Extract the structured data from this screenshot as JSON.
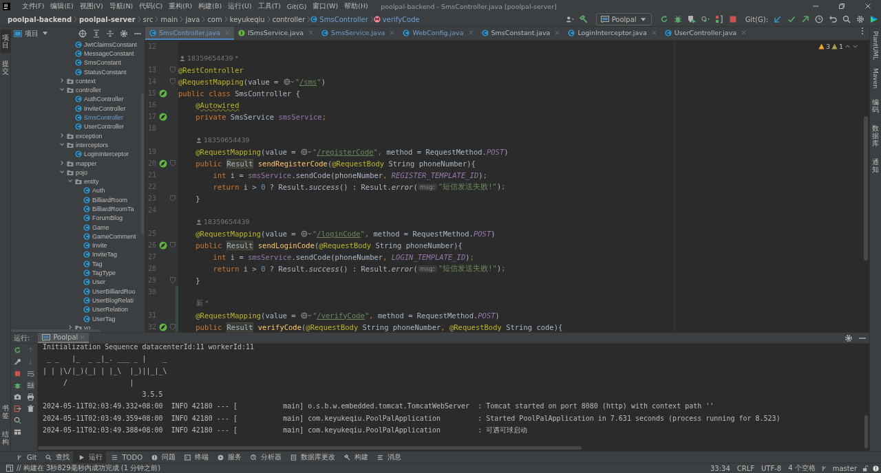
{
  "window": {
    "title": "poolpal-backend - SmsController.java [poolpal-server]"
  },
  "menu": [
    "文件(F)",
    "编辑(E)",
    "视图(V)",
    "导航(N)",
    "代码(C)",
    "重构(R)",
    "构建(B)",
    "运行(U)",
    "工具(T)",
    "Git(G)",
    "窗口(W)",
    "帮助(H)"
  ],
  "breadcrumbs": [
    {
      "label": "poolpal-backend",
      "kind": "module"
    },
    {
      "label": "poolpal-server",
      "kind": "module"
    },
    {
      "label": "src",
      "kind": "folder"
    },
    {
      "label": "main",
      "kind": "folder"
    },
    {
      "label": "java",
      "kind": "folder"
    },
    {
      "label": "com",
      "kind": "folder"
    },
    {
      "label": "keyukeqiu",
      "kind": "folder"
    },
    {
      "label": "controller",
      "kind": "folder"
    },
    {
      "label": "SmsController",
      "kind": "class"
    },
    {
      "label": "verifyCode",
      "kind": "method"
    }
  ],
  "toolbar": {
    "run_config": "Poolpal",
    "git_label": "Git(G):"
  },
  "left_strip": {
    "top": [
      {
        "label": "项目",
        "selected": true
      },
      {
        "label": "提交",
        "selected": false
      }
    ],
    "bottom": [
      "书签",
      "结构"
    ]
  },
  "right_strip": [
    {
      "label": "PlantUML",
      "kind": "rotated"
    },
    {
      "label": "Maven",
      "kind": "rotated"
    },
    {
      "label": "编码",
      "kind": "stacked"
    },
    {
      "label": "数据库",
      "kind": "stacked"
    },
    {
      "label": "通知",
      "kind": "stacked"
    }
  ],
  "project": {
    "title": "项目",
    "tree": {
      "continued_items": [
        {
          "label": "JwtClaimsConstant",
          "kind": "class",
          "modified": false
        },
        {
          "label": "MessageConstant",
          "kind": "class",
          "modified": false
        },
        {
          "label": "SmsConstant",
          "kind": "class",
          "modified": false
        },
        {
          "label": "StatusConstant",
          "kind": "class",
          "modified": false
        }
      ],
      "items": [
        {
          "label": "context",
          "kind": "folder",
          "expanded": false
        },
        {
          "label": "controller",
          "kind": "folder",
          "expanded": true,
          "children": [
            {
              "label": "AuthController",
              "kind": "class",
              "modified": false
            },
            {
              "label": "InviteController",
              "kind": "class",
              "modified": false
            },
            {
              "label": "SmsController",
              "kind": "class",
              "modified": true
            },
            {
              "label": "UserController",
              "kind": "class",
              "modified": false
            }
          ]
        },
        {
          "label": "exception",
          "kind": "folder",
          "expanded": false
        },
        {
          "label": "interceptors",
          "kind": "folder",
          "expanded": true,
          "children": [
            {
              "label": "LoginInterceptor",
              "kind": "class",
              "modified": false
            }
          ]
        },
        {
          "label": "mapper",
          "kind": "folder",
          "expanded": false
        },
        {
          "label": "pojo",
          "kind": "folder",
          "expanded": true,
          "children": [
            {
              "label": "entity",
              "kind": "folder",
              "expanded": true,
              "children": [
                {
                  "label": "Auth",
                  "kind": "class",
                  "modified": false
                },
                {
                  "label": "BilliardRoom",
                  "kind": "class",
                  "modified": false
                },
                {
                  "label": "BilliardRoomTa",
                  "kind": "class",
                  "modified": false
                },
                {
                  "label": "ForumBlog",
                  "kind": "class",
                  "modified": false
                },
                {
                  "label": "Game",
                  "kind": "class",
                  "modified": false
                },
                {
                  "label": "GameComment",
                  "kind": "class",
                  "modified": false
                },
                {
                  "label": "Invite",
                  "kind": "class",
                  "modified": false
                },
                {
                  "label": "InviteTag",
                  "kind": "class",
                  "modified": false
                },
                {
                  "label": "Tag",
                  "kind": "class",
                  "modified": false
                },
                {
                  "label": "TagType",
                  "kind": "class",
                  "modified": false
                },
                {
                  "label": "User",
                  "kind": "class",
                  "modified": false
                },
                {
                  "label": "UserBilliardRoo",
                  "kind": "class",
                  "modified": false
                },
                {
                  "label": "UserBlogRelati",
                  "kind": "class",
                  "modified": false
                },
                {
                  "label": "UserRelation",
                  "kind": "class",
                  "modified": false
                },
                {
                  "label": "UserTag",
                  "kind": "class",
                  "modified": false
                }
              ]
            },
            {
              "label": "vo",
              "kind": "folder",
              "expanded": false
            }
          ]
        }
      ]
    }
  },
  "tabs": [
    {
      "label": "SmsController.java",
      "kind": "class",
      "selected": true,
      "modified": true
    },
    {
      "label": "ISmsService.java",
      "kind": "interface",
      "selected": false,
      "modified": false
    },
    {
      "label": "SmsService.java",
      "kind": "class",
      "selected": false,
      "modified": true
    },
    {
      "label": "WebConfig.java",
      "kind": "class",
      "selected": false,
      "modified": true
    },
    {
      "label": "SmsConstant.java",
      "kind": "class",
      "selected": false,
      "modified": false
    },
    {
      "label": "LoginInterceptor.java",
      "kind": "class",
      "selected": false,
      "modified": false
    },
    {
      "label": "UserController.java",
      "kind": "class",
      "selected": false,
      "modified": false
    }
  ],
  "inspections": {
    "warnings": "3",
    "weak_warnings": "1"
  },
  "code": [
    {
      "kind": "code_class",
      "n": "12"
    },
    {
      "kind": "author_class",
      "text": "18359654439 *",
      "user_icon": true
    },
    {
      "kind": "code_class",
      "n": "13",
      "fold": true,
      "tokens": [
        {
          "kind": "ann",
          "t": "@RestController"
        }
      ]
    },
    {
      "kind": "code_class",
      "n": "14",
      "fold": true,
      "tokens": [
        {
          "kind": "ann",
          "t": "@RequestMapping"
        },
        {
          "kind": "p",
          "t": "(value = "
        },
        {
          "kind": "globe"
        },
        {
          "kind": "str",
          "t": "\""
        },
        {
          "kind": "link",
          "t": "/sms"
        },
        {
          "kind": "str",
          "t": "\""
        },
        {
          "kind": "p",
          "t": ")"
        }
      ]
    },
    {
      "kind": "code_class",
      "n": "15",
      "bean": true,
      "tokens": [
        {
          "kind": "kw",
          "t": "public class "
        },
        {
          "kind": "p",
          "t": "SmsController {"
        }
      ]
    },
    {
      "kind": "code_member",
      "n": "16",
      "tokens": [
        {
          "kind": "annw",
          "t": "@Autowired"
        }
      ]
    },
    {
      "kind": "code_member",
      "n": "17",
      "bean": true,
      "tokens": [
        {
          "kind": "kw",
          "t": "private "
        },
        {
          "kind": "p",
          "t": "SmsService "
        },
        {
          "kind": "fld",
          "t": "smsService"
        },
        {
          "kind": "kw",
          "t": ";"
        }
      ]
    },
    {
      "kind": "code_class",
      "n": "18"
    },
    {
      "kind": "author_member",
      "text": "18359654439",
      "user_icon": true
    },
    {
      "kind": "code_member",
      "n": "19",
      "tokens": [
        {
          "kind": "ann",
          "t": "@RequestMapping"
        },
        {
          "kind": "p",
          "t": "(value = "
        },
        {
          "kind": "globe"
        },
        {
          "kind": "str",
          "t": "\""
        },
        {
          "kind": "link",
          "t": "/registerCode"
        },
        {
          "kind": "str",
          "t": "\""
        },
        {
          "kind": "kw",
          "t": ", "
        },
        {
          "kind": "p",
          "t": "method = RequestMethod."
        },
        {
          "kind": "cst",
          "t": "POST"
        },
        {
          "kind": "p",
          "t": ")"
        }
      ]
    },
    {
      "kind": "code_member",
      "n": "20",
      "bean": true,
      "fold": true,
      "tokens": [
        {
          "kind": "kw",
          "t": "public "
        },
        {
          "kind": "hl",
          "t": "Result"
        },
        {
          "kind": "fn",
          "t": "sendRegisterCode"
        },
        {
          "kind": "p",
          "t": "("
        },
        {
          "kind": "ann",
          "t": "@RequestBody"
        },
        {
          "kind": "p",
          "t": " String phoneNumber){"
        }
      ]
    },
    {
      "kind": "code_body",
      "n": "21",
      "tokens": [
        {
          "kind": "kw",
          "t": "int "
        },
        {
          "kind": "p",
          "t": "i = "
        },
        {
          "kind": "fld",
          "t": "smsService"
        },
        {
          "kind": "p",
          "t": ".sendCode(phoneNumber"
        },
        {
          "kind": "kw",
          "t": ", "
        },
        {
          "kind": "cst",
          "t": "REGISTER_TEMPLATE_ID"
        },
        {
          "kind": "p",
          "t": ")"
        },
        {
          "kind": "kw",
          "t": ";"
        }
      ]
    },
    {
      "kind": "code_body",
      "n": "22",
      "tokens": [
        {
          "kind": "kw",
          "t": "return "
        },
        {
          "kind": "p",
          "t": "i > "
        },
        {
          "kind": "num",
          "t": "0"
        },
        {
          "kind": "p",
          "t": " ? Result."
        },
        {
          "kind": "it",
          "t": "success"
        },
        {
          "kind": "p",
          "t": "() : Result."
        },
        {
          "kind": "it",
          "t": "error"
        },
        {
          "kind": "p",
          "t": "("
        },
        {
          "kind": "hint",
          "t": "msg:"
        },
        {
          "kind": "str",
          "t": "\"短信发送失败!\""
        },
        {
          "kind": "p",
          "t": ")"
        },
        {
          "kind": "kw",
          "t": ";"
        }
      ]
    },
    {
      "kind": "code_member",
      "n": "23",
      "fold": true,
      "tokens": [
        {
          "kind": "p",
          "t": "}"
        }
      ]
    },
    {
      "kind": "code_class",
      "n": "24"
    },
    {
      "kind": "author_member",
      "text": "18359654439",
      "user_icon": true
    },
    {
      "kind": "code_member",
      "n": "25",
      "tokens": [
        {
          "kind": "ann",
          "t": "@RequestMapping"
        },
        {
          "kind": "p",
          "t": "(value = "
        },
        {
          "kind": "globe"
        },
        {
          "kind": "str",
          "t": "\""
        },
        {
          "kind": "link",
          "t": "/loginCode"
        },
        {
          "kind": "str",
          "t": "\""
        },
        {
          "kind": "kw",
          "t": ", "
        },
        {
          "kind": "p",
          "t": "method = RequestMethod."
        },
        {
          "kind": "cst",
          "t": "POST"
        },
        {
          "kind": "p",
          "t": ")"
        }
      ]
    },
    {
      "kind": "code_member",
      "n": "26",
      "bean": true,
      "fold": true,
      "tokens": [
        {
          "kind": "kw",
          "t": "public "
        },
        {
          "kind": "hl",
          "t": "Result"
        },
        {
          "kind": "fn",
          "t": "sendLoginCode"
        },
        {
          "kind": "p",
          "t": "("
        },
        {
          "kind": "ann",
          "t": "@RequestBody"
        },
        {
          "kind": "p",
          "t": " String phoneNumber){"
        }
      ]
    },
    {
      "kind": "code_body",
      "n": "27",
      "tokens": [
        {
          "kind": "kw",
          "t": "int "
        },
        {
          "kind": "p",
          "t": "i = "
        },
        {
          "kind": "fld",
          "t": "smsService"
        },
        {
          "kind": "p",
          "t": ".sendCode(phoneNumber"
        },
        {
          "kind": "kw",
          "t": ", "
        },
        {
          "kind": "cst",
          "t": "LOGIN_TEMPLATE_ID"
        },
        {
          "kind": "p",
          "t": ")"
        },
        {
          "kind": "kw",
          "t": ";"
        }
      ]
    },
    {
      "kind": "code_body",
      "n": "28",
      "tokens": [
        {
          "kind": "kw",
          "t": "return "
        },
        {
          "kind": "p",
          "t": "i > "
        },
        {
          "kind": "num",
          "t": "0"
        },
        {
          "kind": "p",
          "t": " ? Result."
        },
        {
          "kind": "it",
          "t": "success"
        },
        {
          "kind": "p",
          "t": "() : Result."
        },
        {
          "kind": "it",
          "t": "error"
        },
        {
          "kind": "p",
          "t": "("
        },
        {
          "kind": "hint",
          "t": "msg:"
        },
        {
          "kind": "str",
          "t": "\"短信发送失败!\""
        },
        {
          "kind": "p",
          "t": ")"
        },
        {
          "kind": "kw",
          "t": ";"
        }
      ]
    },
    {
      "kind": "code_member",
      "n": "29",
      "fold": true,
      "tokens": [
        {
          "kind": "p",
          "t": "}"
        }
      ]
    },
    {
      "kind": "code_class",
      "n": "30",
      "changed": true
    },
    {
      "kind": "author_member",
      "text": "新 *",
      "user_icon": false,
      "changed": true
    },
    {
      "kind": "code_member",
      "n": "31",
      "changed": true,
      "tokens": [
        {
          "kind": "ann",
          "t": "@RequestMapping"
        },
        {
          "kind": "p",
          "t": "(value = "
        },
        {
          "kind": "globe"
        },
        {
          "kind": "str",
          "t": "\""
        },
        {
          "kind": "link",
          "t": "/verifyCode"
        },
        {
          "kind": "str",
          "t": "\""
        },
        {
          "kind": "kw",
          "t": ", "
        },
        {
          "kind": "p",
          "t": "method = RequestMethod."
        },
        {
          "kind": "cst",
          "t": "POST"
        },
        {
          "kind": "p",
          "t": ")"
        }
      ]
    },
    {
      "kind": "code_member",
      "n": "32",
      "changed": true,
      "bean": true,
      "fold": true,
      "tokens": [
        {
          "kind": "kw",
          "t": "public "
        },
        {
          "kind": "hl",
          "t": "Result"
        },
        {
          "kind": "fn",
          "t": "verifyCode"
        },
        {
          "kind": "p",
          "t": "("
        },
        {
          "kind": "ann",
          "t": "@RequestBody"
        },
        {
          "kind": "p",
          "t": " String phoneNumber"
        },
        {
          "kind": "kw",
          "t": ", "
        },
        {
          "kind": "ann",
          "t": "@RequestBody"
        },
        {
          "kind": "p",
          "t": " String code){"
        }
      ]
    }
  ],
  "run": {
    "label": "运行:",
    "tab": "Poolpal",
    "console": [
      "Initialization Sequence datacenterId:11 workerId:11",
      " _ _   |_  _ _|_. ___ _ |    _",
      "| | |\\/|_)(_| | |_\\  |_)||_|_\\",
      "     /               |",
      "                        3.5.5",
      "2024-05-11T02:03:49.332+08:00  INFO 42180 --- [           main] o.s.b.w.embedded.tomcat.TomcatWebServer  : Tomcat started on port 8080 (http) with context path ''",
      "2024-05-11T02:03:49.359+08:00  INFO 42180 --- [           main] com.keyukeqiu.PoolPalApplication         : Started PoolPalApplication in 7.631 seconds (process running for 8.523)",
      "2024-05-11T02:03:49.388+08:00  INFO 42180 --- [           main] com.keyukeqiu.PoolPalApplication         : 可遇可球启动"
    ]
  },
  "bottom_tools": [
    {
      "label": "Git",
      "kind": "git",
      "selected": false
    },
    {
      "label": "查找",
      "kind": "search",
      "selected": false
    },
    {
      "label": "运行",
      "kind": "run",
      "selected": true
    },
    {
      "label": "TODO",
      "kind": "todo",
      "selected": false
    },
    {
      "label": "问题",
      "kind": "problems",
      "selected": false
    },
    {
      "label": "终端",
      "kind": "terminal",
      "selected": false
    },
    {
      "label": "服务",
      "kind": "services",
      "selected": false
    },
    {
      "label": "分析器",
      "kind": "profiler",
      "selected": false
    },
    {
      "label": "数据库更改",
      "kind": "database",
      "selected": false
    },
    {
      "label": "构建",
      "kind": "build",
      "selected": false
    },
    {
      "label": "消息",
      "kind": "messages",
      "selected": false
    }
  ],
  "status": {
    "message": "// 构建在 3秒829毫秒内成功完成 (1 分钟之前)",
    "position": "33:34",
    "line_ending": "CRLF",
    "encoding": "UTF-8",
    "indent": "4 个空格",
    "branch": "master"
  }
}
